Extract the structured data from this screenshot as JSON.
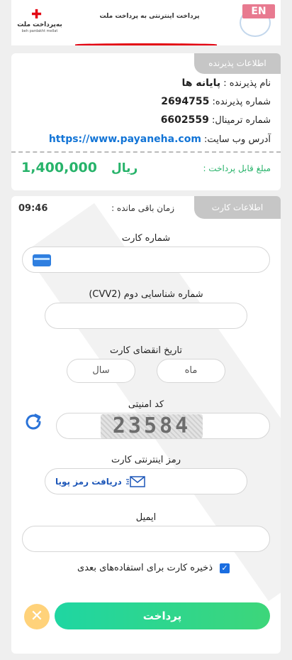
{
  "header": {
    "title": "پرداخت اینترنتی به پرداخت ملت",
    "logo_text": "به‌پرداخت ملت",
    "logo_sub": "beh pardakht mellat",
    "lang_button": "EN"
  },
  "merchant": {
    "section_title": "اطلاعات پذیرنده",
    "name_label": "نام پذیرنده : ",
    "name_value": "پایانه ها",
    "number_label": "شماره پذیرنده: ",
    "number_value": "2694755",
    "terminal_label": "شماره ترمینال: ",
    "terminal_value": "6602559",
    "site_label": "آدرس وب سایت: ",
    "site_value": "https://www.payaneha.com",
    "amount_label": "مبلغ قابل پرداخت :",
    "amount_value": "1,400,000",
    "amount_unit": "ریال"
  },
  "card": {
    "section_title": "اطلاعات کارت",
    "timer_label": "زمان باقی مانده :",
    "timer_value": "09:46",
    "card_number_label": "شماره کارت",
    "cvv2_label": "شماره شناسایی دوم (CVV2)",
    "expiry_label": "تاریخ انقضای کارت",
    "month_placeholder": "ماه",
    "year_placeholder": "سال",
    "captcha_label": "کد امنیتی",
    "captcha_text": "23584",
    "password_label": "رمز اینترنتی کارت",
    "otp_button": "دریافت رمز پویا",
    "email_label": "ایمیل",
    "save_card_label": "ذخیره کارت برای استفاده‌های بعدی",
    "pay_button": "پرداخت"
  },
  "colors": {
    "accent_red": "#e30613",
    "amount_green": "#27b36a",
    "link_blue": "#1274d6",
    "pay_gradient": [
      "#1fd6a2",
      "#3dd67a"
    ]
  }
}
